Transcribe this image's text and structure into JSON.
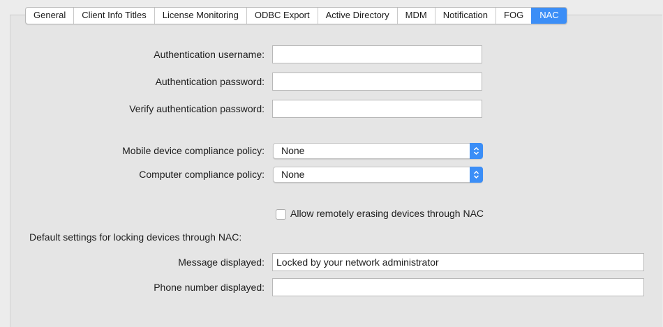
{
  "tabs": [
    {
      "label": "General",
      "active": false
    },
    {
      "label": "Client Info Titles",
      "active": false
    },
    {
      "label": "License Monitoring",
      "active": false
    },
    {
      "label": "ODBC Export",
      "active": false
    },
    {
      "label": "Active Directory",
      "active": false
    },
    {
      "label": "MDM",
      "active": false
    },
    {
      "label": "Notification",
      "active": false
    },
    {
      "label": "FOG",
      "active": false
    },
    {
      "label": "NAC",
      "active": true
    }
  ],
  "auth": {
    "username_label": "Authentication username:",
    "username_value": "",
    "password_label": "Authentication password:",
    "password_value": "",
    "verify_label": "Verify authentication password:",
    "verify_value": ""
  },
  "compliance": {
    "mobile_label": "Mobile device compliance policy:",
    "mobile_value": "None",
    "computer_label": "Computer compliance policy:",
    "computer_value": "None"
  },
  "erase": {
    "label": "Allow remotely erasing devices through NAC",
    "checked": false
  },
  "locking": {
    "heading": "Default settings for locking devices through NAC:",
    "message_label": "Message displayed:",
    "message_value": "Locked by your network administrator",
    "phone_label": "Phone number displayed:",
    "phone_value": ""
  },
  "colors": {
    "accent": "#3b8ef7",
    "window_background": "#ececec"
  },
  "icons": {
    "popup_arrows": "up-down-chevron-icon"
  }
}
